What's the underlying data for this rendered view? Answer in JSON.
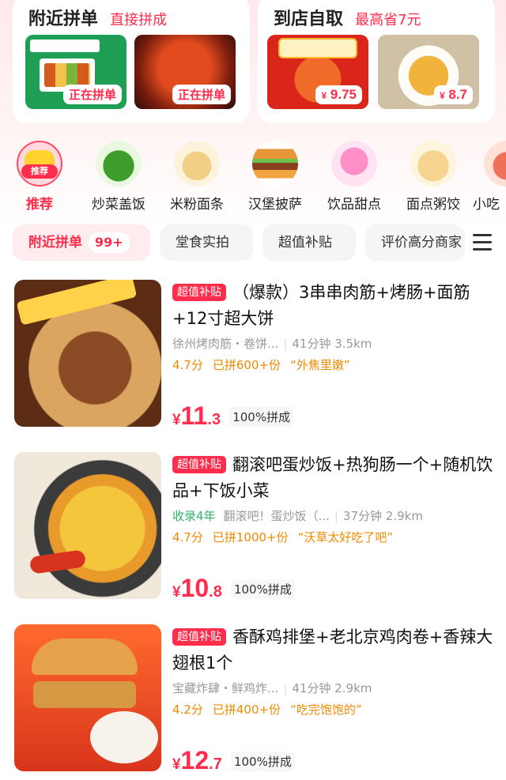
{
  "promos": [
    {
      "title": "附近拼单",
      "subtitle": "直接拼成",
      "images": [
        {
          "icon": "fresh-box-meal-image",
          "tag": "正在拼单"
        },
        {
          "icon": "braised-meat-image",
          "tag": "正在拼单"
        }
      ]
    },
    {
      "title": "到店自取",
      "subtitle": "最高省7元",
      "images": [
        {
          "icon": "red-bowl-rice-image",
          "price_yen": "¥",
          "price": "9.75"
        },
        {
          "icon": "fried-noodles-image",
          "price_yen": "¥",
          "price": "8.7"
        }
      ]
    }
  ],
  "categories": [
    {
      "label": "推荐",
      "badge": "推荐",
      "icon": "recommend-icon",
      "active": true
    },
    {
      "label": "炒菜盖饭",
      "icon": "vegetable-icon"
    },
    {
      "label": "米粉面条",
      "icon": "noodle-icon"
    },
    {
      "label": "汉堡披萨",
      "icon": "burger-icon"
    },
    {
      "label": "饮品甜点",
      "icon": "dessert-icon"
    },
    {
      "label": "面点粥饺",
      "icon": "dumpling-icon"
    },
    {
      "label": "小吃",
      "icon": "snack-icon"
    }
  ],
  "filters": [
    {
      "label": "附近拼单",
      "badge": "99+",
      "active": true
    },
    {
      "label": "堂食实拍"
    },
    {
      "label": "超值补贴"
    },
    {
      "label": "评价高分商家"
    }
  ],
  "items": [
    {
      "tag": "超值补贴",
      "title": "（爆款）3串串肉筋+烤肠+面筋+12寸超大饼",
      "shop_years": "",
      "shop": "徐州烤肉筋・卷饼...",
      "time": "41分钟",
      "distance": "3.5km",
      "score": "4.7分",
      "sold": "已拼600+份",
      "quote": "“外焦里嫩”",
      "price_yen": "¥",
      "price_int": "11",
      "price_dec": ".3",
      "grouped": "100%拼成"
    },
    {
      "tag": "超值补贴",
      "title": "翻滚吧蛋炒饭+热狗肠一个+随机饮品+下饭小菜",
      "shop_years": "收录4年",
      "shop": "翻滚吧！蛋炒饭（...",
      "time": "37分钟",
      "distance": "2.9km",
      "score": "4.7分",
      "sold": "已拼1000+份",
      "quote": "“沃草太好吃了吧”",
      "price_yen": "¥",
      "price_int": "10",
      "price_dec": ".8",
      "grouped": "100%拼成"
    },
    {
      "tag": "超值补贴",
      "title": "香酥鸡排堡+老北京鸡肉卷+香辣大翅根1个",
      "shop_years": "",
      "shop": "宝藏炸肆・鲜鸡炸...",
      "time": "41分钟",
      "distance": "2.9km",
      "score": "4.2分",
      "sold": "已拼400+份",
      "quote": "“吃完饱饱的”",
      "price_yen": "¥",
      "price_int": "12",
      "price_dec": ".7",
      "grouped": "100%拼成"
    }
  ]
}
